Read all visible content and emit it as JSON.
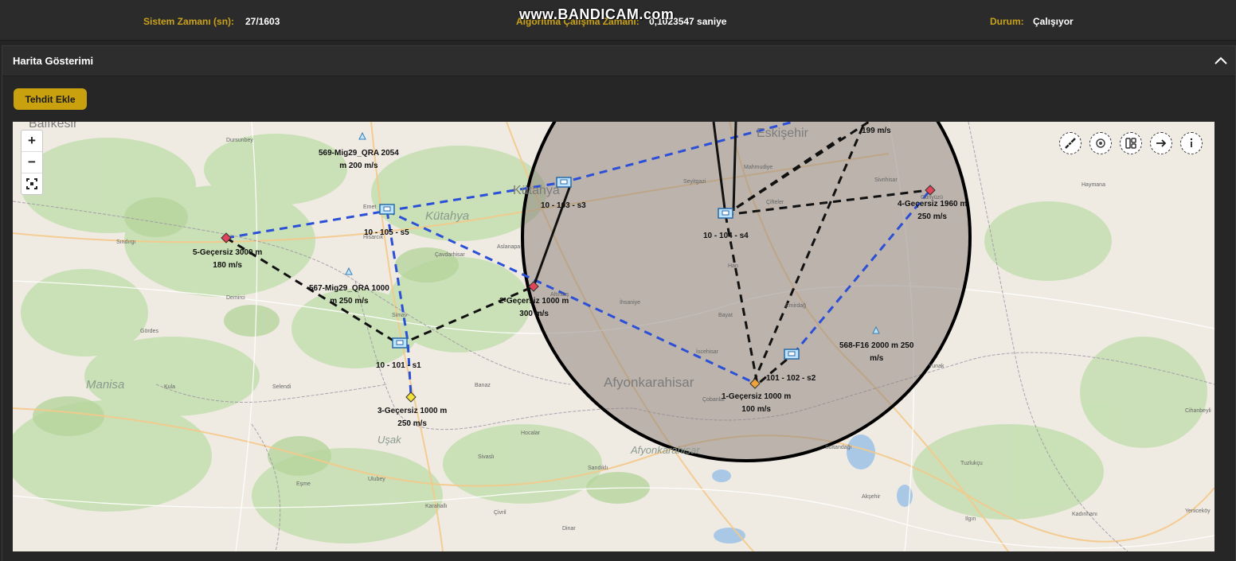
{
  "watermark": "www.BANDICAM.com",
  "status": {
    "system_time_label": "Sistem Zamanı (sn):",
    "system_time_value": "27/1603",
    "algo_time_label": "Algoritma Çalışma Zamanı:",
    "algo_time_value": "0,1023547 saniye",
    "state_label": "Durum:",
    "state_value": "Çalışıyor"
  },
  "panel": {
    "title": "Harita Gösterimi",
    "add_button": "Tehdit Ekle"
  },
  "colors": {
    "accent": "#c9a10f",
    "route_blue": "#2b4fd6",
    "route_black": "#111111",
    "threat_red": "#e0455a"
  },
  "map": {
    "zoom": {
      "in": "+",
      "out": "−"
    },
    "tools": [
      "ruler-icon",
      "gear-icon",
      "layers-icon",
      "arrow-right-icon",
      "info-icon"
    ],
    "cities": {
      "balikesir": "Balıkesir",
      "kutahya_top": "Kütahya",
      "kutahya": "Kütahya",
      "eskisehir": "Eskişehir",
      "manisa": "Manisa",
      "afyonkarahisar": "Afyonkarahisar",
      "afyonkarahisar2": "Afyonkarahisar",
      "usak": "Uşak"
    },
    "towns": {
      "dursunbey": "Dursunbey",
      "sindirgi": "Sındırgı",
      "demirci": "Demirci",
      "gordes": "Gördes",
      "selendi": "Selendi",
      "kula": "Kula",
      "simav": "Simav",
      "emet": "Emet",
      "hisarcik": "Hisarcık",
      "cavdarhisar": "Çavdarhisar",
      "aslanapa": "Aslanapa",
      "altintas": "Altıntaş",
      "banaz": "Banaz",
      "sivasli": "Sivaslı",
      "ulubey": "Ulubey",
      "esme": "Eşme",
      "karahalli": "Karahallı",
      "civril": "Çivril",
      "sandikli": "Sandıklı",
      "hocalar": "Hocalar",
      "dinar": "Dinar",
      "seyitgazi": "Seyitgazi",
      "mahmudiye": "Mahmudiye",
      "cifteler": "Çifteler",
      "sivrihisar": "Sivrihisar",
      "han": "Han",
      "ihsaniye": "İhsaniye",
      "iscehisar": "İscehisar",
      "bayat": "Bayat",
      "emirdag": "Emirdağ",
      "yunak": "Yunak",
      "cobanlar": "Çobanlar",
      "sultandagi": "Sultandağı",
      "aksehir": "Akşehir",
      "tuzlukcu": "Tuzlukçu",
      "haymana": "Haymana",
      "cihanbeyli": "Cihanbeyli",
      "kadinhani": "Kadınhanı",
      "ilgin": "Ilgın",
      "yenice": "Yeniceköy",
      "gunyuzu": "Günyüzü"
    },
    "labels": {
      "mig569": [
        "569-Mig29_QRA 2054",
        "m 200 m/s"
      ],
      "t5": [
        "5-Geçersiz 3000 m",
        "180 m/s"
      ],
      "mig567": [
        "567-Mig29_QRA 1000",
        "m 250 m/s"
      ],
      "s5": [
        "10 - 105 - s5"
      ],
      "s3": [
        "10 - 103 - s3"
      ],
      "s4": [
        "10 - 104 - s4"
      ],
      "t2": [
        "2-Geçersiz 1000 m",
        "300 m/s"
      ],
      "s1": [
        "10 - 101 - s1"
      ],
      "t3": [
        "3-Geçersiz 1000 m",
        "250 m/s"
      ],
      "t1": [
        "1-Geçersiz 1000 m",
        "100 m/s"
      ],
      "s2": [
        "101 - 102 - s2"
      ],
      "f16": [
        "568-F16 2000 m 250",
        "m/s"
      ],
      "t4": [
        "4-Geçersiz 1960 m",
        "250 m/s"
      ],
      "top": [
        "199 m/s"
      ]
    }
  }
}
